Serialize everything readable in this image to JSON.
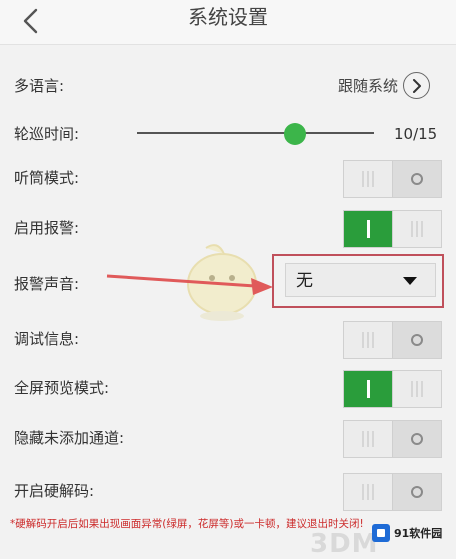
{
  "header": {
    "title": "系统设置",
    "back_icon": "chevron-left-icon"
  },
  "settings": {
    "language": {
      "label": "多语言:",
      "value": "跟随系统",
      "icon": "chevron-right-circle-icon"
    },
    "patrol": {
      "label": "轮巡时间:",
      "value_text": "10/15",
      "value": 10,
      "max": 15
    },
    "earpiece": {
      "label": "听筒模式:",
      "on": false
    },
    "alarm": {
      "label": "启用报警:",
      "on": true
    },
    "alarm_sound": {
      "label": "报警声音:",
      "value": "无"
    },
    "debug": {
      "label": "调试信息:",
      "on": false
    },
    "fullscreen": {
      "label": "全屏预览模式:",
      "on": true
    },
    "hide_channels": {
      "label": "隐藏未添加通道:",
      "on": false
    },
    "hw_decode": {
      "label": "开启硬解码:",
      "on": false
    }
  },
  "note": "*硬解码开启后如果出现画面异常(绿屏，花屏等)或一卡顿，建议退出时关闭!",
  "watermarks": {
    "left": "3DM",
    "right": "91软件园"
  },
  "colors": {
    "accent_green": "#2a9d3b",
    "slider_green": "#3cb54a",
    "highlight_red": "#c0505b",
    "note_red": "#cc2b2b"
  }
}
